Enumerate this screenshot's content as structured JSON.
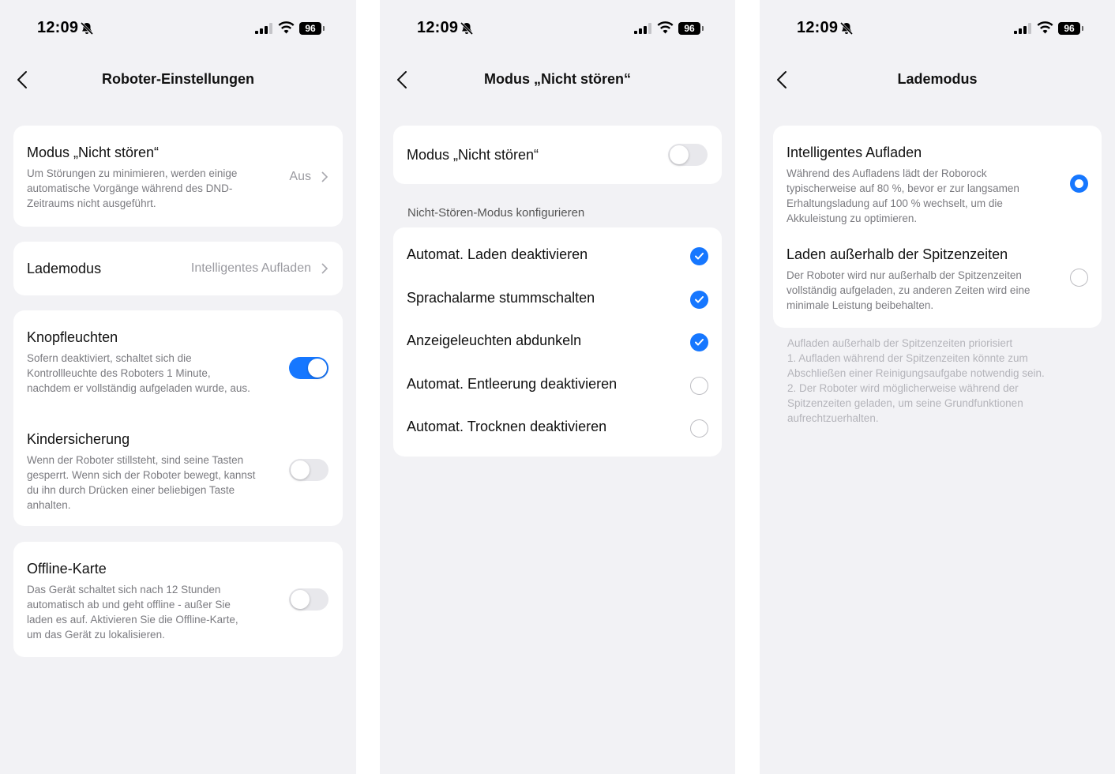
{
  "status": {
    "time": "12:09",
    "battery": "96"
  },
  "screen1": {
    "nav_title": "Roboter-Einstellungen",
    "dnd": {
      "title": "Modus „Nicht stören“",
      "desc": "Um Störungen zu minimieren, werden einige automatische Vorgänge während des DND-Zeitraums nicht ausgeführt.",
      "value": "Aus"
    },
    "charge": {
      "title": "Lademodus",
      "value": "Intelligentes Aufladen"
    },
    "buttonlights": {
      "title": "Knopfleuchten",
      "desc": "Sofern deaktiviert, schaltet sich die Kontrollleuchte des Roboters 1 Minute, nachdem er vollständig aufgeladen wurde, aus.",
      "on": true
    },
    "childlock": {
      "title": "Kindersicherung",
      "desc": "Wenn der Roboter stillsteht, sind seine Tasten gesperrt. Wenn sich der Roboter bewegt, kannst du ihn durch Drücken einer beliebigen Taste anhalten.",
      "on": false
    },
    "offline": {
      "title": "Offline-Karte",
      "desc": "Das Gerät schaltet sich nach 12 Stunden automatisch ab und geht offline - außer Sie laden es auf. Aktivieren Sie die Offline-Karte, um das Gerät zu lokalisieren.",
      "on": false
    }
  },
  "screen2": {
    "nav_title": "Modus „Nicht stören“",
    "toggle_label": "Modus „Nicht stören“",
    "toggle_on": false,
    "section_label": "Nicht-Stören-Modus konfigurieren",
    "options": [
      {
        "label": "Automat. Laden deaktivieren",
        "checked": true
      },
      {
        "label": "Sprachalarme stummschalten",
        "checked": true
      },
      {
        "label": "Anzeigeleuchten abdunkeln",
        "checked": true
      },
      {
        "label": "Automat. Entleerung deaktivieren",
        "checked": false
      },
      {
        "label": "Automat. Trocknen deaktivieren",
        "checked": false
      }
    ]
  },
  "screen3": {
    "nav_title": "Lademodus",
    "options": [
      {
        "title": "Intelligentes Aufladen",
        "desc": "Während des Aufladens lädt der Roborock typischerweise auf 80 %, bevor er zur langsamen Erhaltungsladung auf 100 % wechselt, um die Akkuleistung zu optimieren.",
        "selected": true
      },
      {
        "title": "Laden außerhalb der Spitzenzeiten",
        "desc": "Der Roboter wird nur außerhalb der Spitzenzeiten vollständig aufgeladen, zu anderen Zeiten wird eine minimale Leistung beibehalten.",
        "selected": false
      }
    ],
    "footnote": "Aufladen außerhalb der Spitzenzeiten priorisiert\n1. Aufladen während der Spitzenzeiten könnte zum Abschließen einer Reinigungsaufgabe notwendig sein.\n2. Der Roboter wird möglicherweise während der Spitzenzeiten geladen, um seine Grundfunktionen aufrechtzuerhalten."
  },
  "colors": {
    "accent": "#1677ff",
    "background": "#f2f2f5",
    "card": "#ffffff",
    "secondary_text": "#7b7b80"
  },
  "icons": [
    "bell-slash-icon",
    "signal-icon",
    "wifi-icon",
    "battery-icon",
    "back-chevron-icon",
    "chevron-right-icon",
    "checkmark-icon"
  ]
}
